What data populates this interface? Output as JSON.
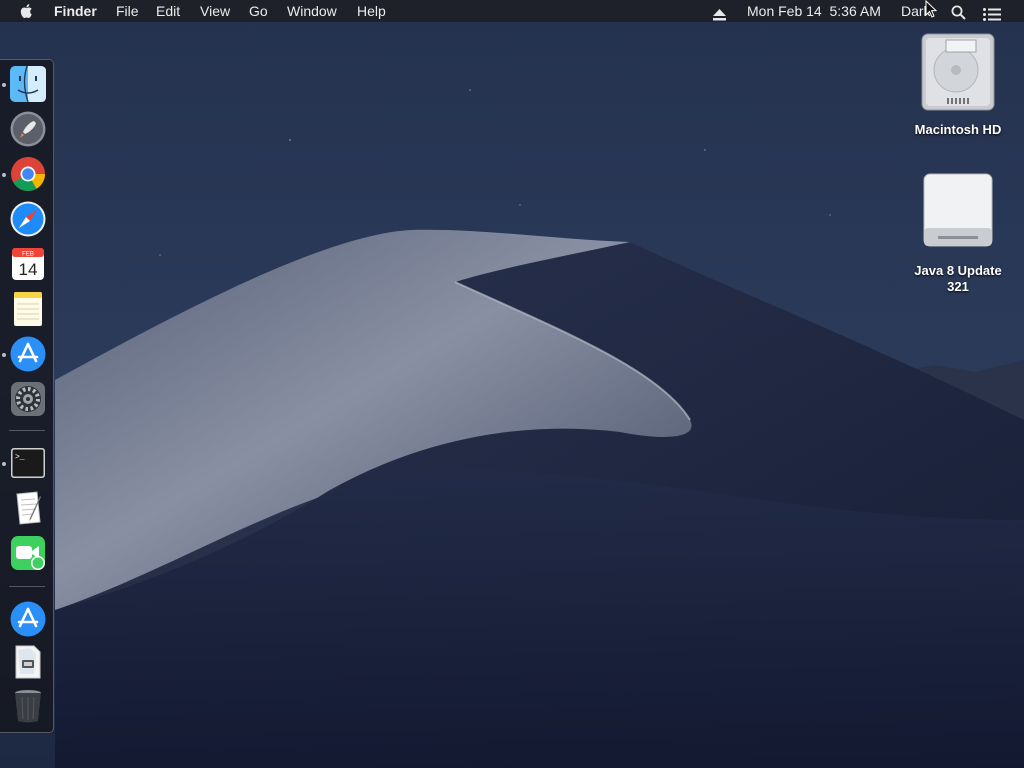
{
  "menubar": {
    "app_name": "Finder",
    "menus": [
      "File",
      "Edit",
      "View",
      "Go",
      "Window",
      "Help"
    ],
    "clock": "Mon Feb 14  5:36 AM",
    "user": "Dark",
    "icons": [
      "apple-icon",
      "eject-icon",
      "spotlight-search-icon",
      "notification-center-icon"
    ]
  },
  "dock": {
    "apps": [
      "Finder",
      "Launchpad",
      "Google Chrome",
      "Safari",
      "Calendar",
      "Notes",
      "App Store",
      "System Preferences",
      "Terminal",
      "TextEdit",
      "FaceTime",
      "App Store",
      "Documents",
      "Trash"
    ],
    "calendar": {
      "month": "FEB",
      "day": "14"
    },
    "terminal_prompt": ">_"
  },
  "desktop": {
    "icons": [
      {
        "label": "Macintosh HD",
        "icon": "hard-drive-icon"
      },
      {
        "label": "Java 8 Update 321",
        "icon": "external-disk-icon"
      }
    ]
  },
  "colors": {
    "sky": "#2a3856",
    "dune_light": "#8f96a8",
    "dune_dark": "#1c2440",
    "menubar": "#1e2026",
    "accent_blue": "#1d8cf8"
  }
}
